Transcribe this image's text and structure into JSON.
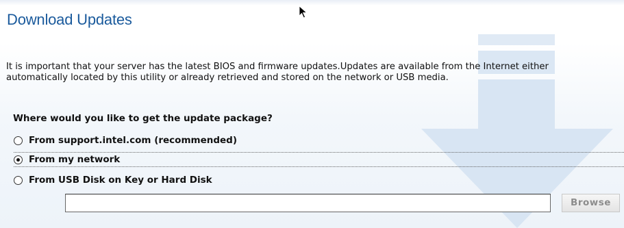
{
  "page": {
    "title": "Download Updates",
    "intro": "It is important that your server has the latest BIOS and firmware updates.Updates are available from the Internet either automatically located by this utility or already retrieved and stored on the network or USB media."
  },
  "question": "Where would you like to get the update package?",
  "options": [
    {
      "label": "From support.intel.com (recommended)",
      "checked": false
    },
    {
      "label": "From my network",
      "checked": true
    },
    {
      "label": "From USB Disk on Key or Hard Disk",
      "checked": false
    }
  ],
  "path_input": {
    "value": "",
    "placeholder": ""
  },
  "browse_button": {
    "label": "Browse",
    "enabled": false
  },
  "colors": {
    "title": "#1a5a9c",
    "watermark": "#d6e4f3",
    "panel": "#edf3f9"
  },
  "icons": [
    "download-arrow-icon",
    "mouse-pointer-icon",
    "radio-icon"
  ]
}
